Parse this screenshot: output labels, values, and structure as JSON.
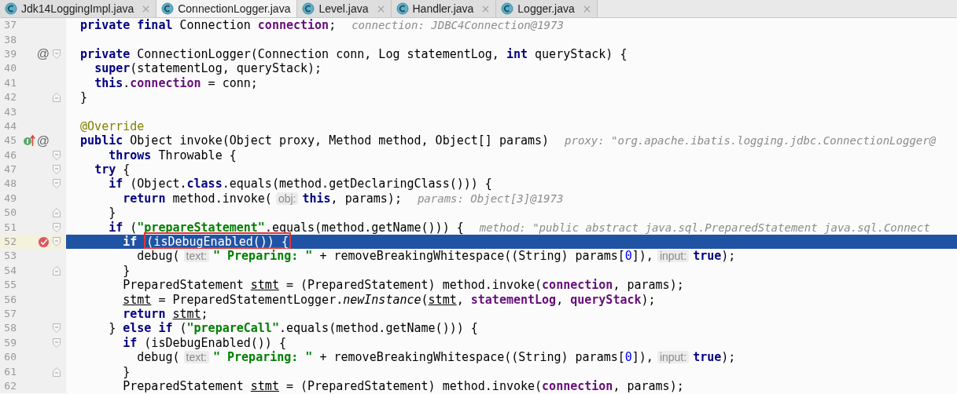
{
  "tabs": [
    {
      "label": "Jdk14LoggingImpl.java",
      "selected": false,
      "close_button": true
    },
    {
      "label": "ConnectionLogger.java",
      "selected": true,
      "close_button": false
    },
    {
      "label": "Level.java",
      "selected": false,
      "close_button": true
    },
    {
      "label": "Handler.java",
      "selected": false,
      "close_button": true
    },
    {
      "label": "Logger.java",
      "selected": false,
      "close_button": true
    }
  ],
  "editor": {
    "lines": [
      {
        "number": "37",
        "selected": false,
        "segments": [
          {
            "kind": "code",
            "tokens": [
              {
                "kind": "keyword",
                "text": "  private final "
              },
              {
                "kind": "plain",
                "text": "Connection "
              },
              {
                "kind": "field",
                "text": "connection"
              },
              {
                "kind": "plain",
                "text": ";"
              }
            ]
          },
          {
            "kind": "value",
            "text": "connection: JDBC4Connection@1973"
          }
        ]
      },
      {
        "number": "38",
        "selected": false
      },
      {
        "number": "39",
        "selected": false,
        "fold_start": true,
        "markers": [
          {
            "kind": "override",
            "symbol": "@"
          }
        ],
        "segments": [
          {
            "kind": "code",
            "tokens": [
              {
                "kind": "keyword",
                "text": "  private "
              },
              {
                "kind": "plain",
                "text": "ConnectionLogger(Connection conn, Log statementLog, "
              },
              {
                "kind": "keyword",
                "text": "int"
              },
              {
                "kind": "plain",
                "text": " queryStack) {"
              }
            ]
          }
        ]
      },
      {
        "number": "40",
        "selected": false,
        "segments": [
          {
            "kind": "code",
            "tokens": [
              {
                "kind": "keyword",
                "text": "    super"
              },
              {
                "kind": "plain",
                "text": "(statementLog, queryStack);"
              }
            ]
          }
        ]
      },
      {
        "number": "41",
        "selected": false,
        "segments": [
          {
            "kind": "code",
            "tokens": [
              {
                "kind": "keyword",
                "text": "    this"
              },
              {
                "kind": "plain",
                "text": "."
              },
              {
                "kind": "field",
                "text": "connection"
              },
              {
                "kind": "plain",
                "text": " = conn;"
              }
            ]
          }
        ]
      },
      {
        "number": "42",
        "selected": false,
        "fold_end": true,
        "segments": [
          {
            "kind": "code",
            "tokens": [
              {
                "kind": "plain",
                "text": "  }"
              }
            ]
          }
        ]
      },
      {
        "number": "43",
        "selected": false
      },
      {
        "number": "44",
        "selected": false,
        "segments": [
          {
            "kind": "code",
            "tokens": [
              {
                "kind": "annotation",
                "text": "  @Override"
              }
            ]
          }
        ]
      },
      {
        "number": "45",
        "selected": false,
        "markers": [
          {
            "kind": "implemented"
          },
          {
            "kind": "override",
            "symbol": "@"
          }
        ],
        "segments": [
          {
            "kind": "code",
            "tokens": [
              {
                "kind": "keyword",
                "text": "  public "
              },
              {
                "kind": "plain",
                "text": "Object invoke(Object proxy, Method method, Object[] params)"
              }
            ]
          },
          {
            "kind": "value",
            "text": "proxy: \"org.apache.ibatis.logging.jdbc.ConnectionLogger@"
          }
        ]
      },
      {
        "number": "46",
        "selected": false,
        "fold_start": true,
        "segments": [
          {
            "kind": "code",
            "tokens": [
              {
                "kind": "keyword",
                "text": "      throws "
              },
              {
                "kind": "plain",
                "text": "Throwable {"
              }
            ]
          }
        ]
      },
      {
        "number": "47",
        "selected": false,
        "fold_start": true,
        "segments": [
          {
            "kind": "code",
            "tokens": [
              {
                "kind": "keyword",
                "text": "    try "
              },
              {
                "kind": "plain",
                "text": "{"
              }
            ]
          }
        ]
      },
      {
        "number": "48",
        "selected": false,
        "fold_start": true,
        "segments": [
          {
            "kind": "code",
            "tokens": [
              {
                "kind": "keyword",
                "text": "      if "
              },
              {
                "kind": "plain",
                "text": "(Object."
              },
              {
                "kind": "keyword",
                "text": "class"
              },
              {
                "kind": "plain",
                "text": ".equals(method.getDeclaringClass())) {"
              }
            ]
          }
        ]
      },
      {
        "number": "49",
        "selected": false,
        "segments": [
          {
            "kind": "code",
            "tokens": [
              {
                "kind": "keyword",
                "text": "        return "
              },
              {
                "kind": "plain",
                "text": "method.invoke("
              }
            ]
          },
          {
            "kind": "hint",
            "text": "obj:"
          },
          {
            "kind": "code",
            "tokens": [
              {
                "kind": "keyword",
                "text": "this"
              },
              {
                "kind": "plain",
                "text": ", params);"
              }
            ]
          },
          {
            "kind": "value",
            "text": "params: Object[3]@1973"
          }
        ]
      },
      {
        "number": "50",
        "selected": false,
        "fold_end": true,
        "segments": [
          {
            "kind": "code",
            "tokens": [
              {
                "kind": "plain",
                "text": "      }"
              }
            ]
          }
        ]
      },
      {
        "number": "51",
        "selected": false,
        "fold_start": true,
        "segments": [
          {
            "kind": "code",
            "tokens": [
              {
                "kind": "keyword",
                "text": "      if "
              },
              {
                "kind": "plain",
                "text": "("
              },
              {
                "kind": "string",
                "text": "\"prepareStatement\""
              },
              {
                "kind": "plain",
                "text": ".equals(method.getName())) {"
              }
            ]
          },
          {
            "kind": "value",
            "text": "method: \"public abstract java.sql.PreparedStatement java.sql.Connect"
          }
        ]
      },
      {
        "number": "52",
        "selected": true,
        "breakpoint": true,
        "fold_start": true,
        "segments": [
          {
            "kind": "code",
            "tokens": [
              {
                "kind": "keyword",
                "text": "        if "
              }
            ]
          },
          {
            "kind": "boxed",
            "tokens": [
              {
                "kind": "plain",
                "text": "(isDebugEnabled()) {"
              }
            ]
          }
        ]
      },
      {
        "number": "53",
        "selected": false,
        "segments": [
          {
            "kind": "code",
            "tokens": [
              {
                "kind": "plain",
                "text": "          debug("
              }
            ]
          },
          {
            "kind": "hint",
            "text": "text:"
          },
          {
            "kind": "code",
            "tokens": [
              {
                "kind": "string",
                "text": "\" Preparing: \""
              },
              {
                "kind": "plain",
                "text": " + removeBreakingWhitespace((String) params["
              },
              {
                "kind": "number",
                "text": "0"
              },
              {
                "kind": "plain",
                "text": "]),"
              }
            ]
          },
          {
            "kind": "hint",
            "text": "input:"
          },
          {
            "kind": "code",
            "tokens": [
              {
                "kind": "keyword",
                "text": "true"
              },
              {
                "kind": "plain",
                "text": ");"
              }
            ]
          }
        ]
      },
      {
        "number": "54",
        "selected": false,
        "fold_end": true,
        "segments": [
          {
            "kind": "code",
            "tokens": [
              {
                "kind": "plain",
                "text": "        }"
              }
            ]
          }
        ]
      },
      {
        "number": "55",
        "selected": false,
        "segments": [
          {
            "kind": "code",
            "tokens": [
              {
                "kind": "plain",
                "text": "        PreparedStatement "
              },
              {
                "kind": "local",
                "text": "stmt"
              },
              {
                "kind": "plain",
                "text": " = (PreparedStatement) method.invoke("
              },
              {
                "kind": "field",
                "text": "connection"
              },
              {
                "kind": "plain",
                "text": ", params);"
              }
            ]
          }
        ]
      },
      {
        "number": "56",
        "selected": false,
        "segments": [
          {
            "kind": "code",
            "tokens": [
              {
                "kind": "local",
                "text": "        stmt"
              },
              {
                "kind": "plain",
                "text": " = PreparedStatementLogger."
              },
              {
                "kind": "static",
                "text": "newInstance"
              },
              {
                "kind": "plain",
                "text": "("
              },
              {
                "kind": "local",
                "text": "stmt"
              },
              {
                "kind": "plain",
                "text": ", "
              },
              {
                "kind": "field",
                "text": "statementLog"
              },
              {
                "kind": "plain",
                "text": ", "
              },
              {
                "kind": "field",
                "text": "queryStack"
              },
              {
                "kind": "plain",
                "text": ");"
              }
            ]
          }
        ]
      },
      {
        "number": "57",
        "selected": false,
        "segments": [
          {
            "kind": "code",
            "tokens": [
              {
                "kind": "keyword",
                "text": "        return "
              },
              {
                "kind": "local",
                "text": "stmt"
              },
              {
                "kind": "plain",
                "text": ";"
              }
            ]
          }
        ]
      },
      {
        "number": "58",
        "selected": false,
        "fold_start": true,
        "segments": [
          {
            "kind": "code",
            "tokens": [
              {
                "kind": "plain",
                "text": "      } "
              },
              {
                "kind": "keyword",
                "text": "else if "
              },
              {
                "kind": "plain",
                "text": "("
              },
              {
                "kind": "string",
                "text": "\"prepareCall\""
              },
              {
                "kind": "plain",
                "text": ".equals(method.getName())) {"
              }
            ]
          }
        ]
      },
      {
        "number": "59",
        "selected": false,
        "fold_start": true,
        "segments": [
          {
            "kind": "code",
            "tokens": [
              {
                "kind": "keyword",
                "text": "        if "
              },
              {
                "kind": "plain",
                "text": "(isDebugEnabled()) {"
              }
            ]
          }
        ]
      },
      {
        "number": "60",
        "selected": false,
        "segments": [
          {
            "kind": "code",
            "tokens": [
              {
                "kind": "plain",
                "text": "          debug("
              }
            ]
          },
          {
            "kind": "hint",
            "text": "text:"
          },
          {
            "kind": "code",
            "tokens": [
              {
                "kind": "string",
                "text": "\" Preparing: \""
              },
              {
                "kind": "plain",
                "text": " + removeBreakingWhitespace((String) params["
              },
              {
                "kind": "number",
                "text": "0"
              },
              {
                "kind": "plain",
                "text": "]),"
              }
            ]
          },
          {
            "kind": "hint",
            "text": "input:"
          },
          {
            "kind": "code",
            "tokens": [
              {
                "kind": "keyword",
                "text": "true"
              },
              {
                "kind": "plain",
                "text": ");"
              }
            ]
          }
        ]
      },
      {
        "number": "61",
        "selected": false,
        "fold_end": true,
        "segments": [
          {
            "kind": "code",
            "tokens": [
              {
                "kind": "plain",
                "text": "        }"
              }
            ]
          }
        ]
      },
      {
        "number": "62",
        "selected": false,
        "segments": [
          {
            "kind": "code",
            "tokens": [
              {
                "kind": "plain",
                "text": "        PreparedStatement "
              },
              {
                "kind": "local",
                "text": "stmt"
              },
              {
                "kind": "plain",
                "text": " = (PreparedStatement) method.invoke("
              },
              {
                "kind": "field",
                "text": "connection"
              },
              {
                "kind": "plain",
                "text": ", params);"
              }
            ]
          }
        ]
      }
    ]
  }
}
